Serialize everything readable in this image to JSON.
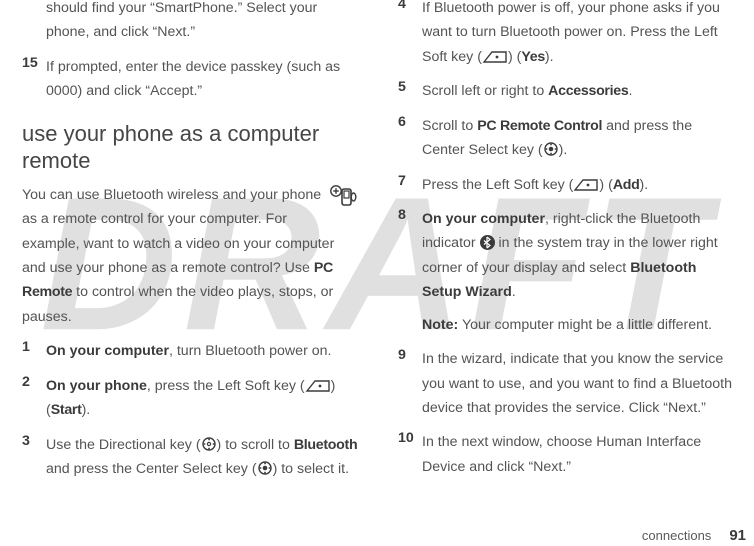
{
  "watermark": "DRAFT",
  "left": {
    "cont_para": "should find your “SmartPhone.” Select your phone, and click “Next.”",
    "step15_num": "15",
    "step15_body": "If prompted, enter the device passkey (such as 0000) and click “Accept.”",
    "heading": "use your phone as a computer remote",
    "intro_a": "You can use Bluetooth wireless and your phone as a remote control for your computer. For example, want to watch a video on your computer and use your phone as a remote control? Use ",
    "intro_pcremote": "PC Remote",
    "intro_b": " to control when the video plays, stops, or pauses.",
    "s1_num": "1",
    "s1_lead": "On your computer",
    "s1_rest": ", turn Bluetooth power on.",
    "s2_num": "2",
    "s2_lead": "On your phone",
    "s2_rest_a": ", press the Left Soft key (",
    "s2_rest_b": ") (",
    "s2_start": "Start",
    "s2_rest_c": ").",
    "s3_num": "3",
    "s3_a": "Use the Directional key (",
    "s3_b": ") to scroll to ",
    "s3_bt": "Bluetooth",
    "s3_c": " and press the Center Select key (",
    "s3_d": ") to select it."
  },
  "right": {
    "s4_num": "4",
    "s4_a": "If Bluetooth power is off, your phone asks if you want to turn Bluetooth power on. Press the Left Soft key (",
    "s4_b": ") (",
    "s4_yes": "Yes",
    "s4_c": ").",
    "s5_num": "5",
    "s5_a": "Scroll left or right to ",
    "s5_acc": "Accessories",
    "s5_b": ".",
    "s6_num": "6",
    "s6_a": "Scroll to ",
    "s6_pcr": "PC Remote Control",
    "s6_b": " and press the Center Select key (",
    "s6_c": ").",
    "s7_num": "7",
    "s7_a": "Press the Left Soft key (",
    "s7_b": ") (",
    "s7_add": "Add",
    "s7_c": ").",
    "s8_num": "8",
    "s8_lead": "On your computer",
    "s8_a": ", right-click the Bluetooth indicator ",
    "s8_b": " in the system tray in the lower right corner of your display and select ",
    "s8_wiz": "Bluetooth Setup Wizard",
    "s8_c": ".",
    "s8_note_lead": "Note:",
    "s8_note": " Your computer might be a little different.",
    "s9_num": "9",
    "s9_a": "In the wizard, indicate that you know the service you want to use, and you want to find a Bluetooth device that provides the service. Click “Next.”",
    "s10_num": "10",
    "s10_a": "In the next window, choose Human Interface Device and click “Next.”"
  },
  "footer": {
    "section": "connections",
    "page": "91"
  }
}
